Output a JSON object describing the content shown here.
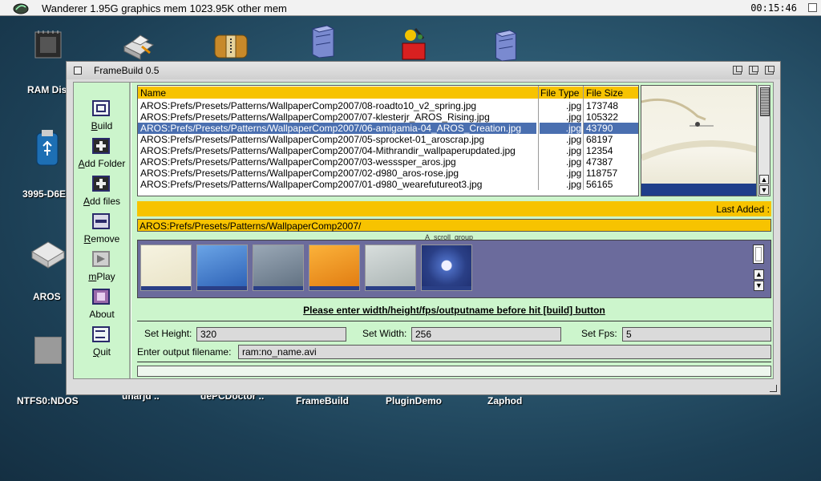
{
  "menubar": {
    "title": "Wanderer 1.95G graphics mem 1023.95K other mem",
    "clock": "00:15:46"
  },
  "desktop": {
    "icons": [
      {
        "label": "RAM Dis",
        "icon": "chip-icon"
      },
      {
        "label": "3995-D6E",
        "icon": "usb-drive-icon"
      },
      {
        "label": "AROS",
        "icon": "hard-drive-icon"
      },
      {
        "label": "NTFS0:NDOS",
        "icon": "volume-icon"
      },
      {
        "label": "FrameBuild",
        "icon": "cabinet-icon"
      },
      {
        "label": "PluginDemo",
        "icon": "paint-icon"
      },
      {
        "label": "Zaphod",
        "icon": "cabinet-icon"
      },
      {
        "label": "unarjd ..",
        "icon": "printer-icon"
      },
      {
        "label": "dePCDoctor ..",
        "icon": "archive-icon"
      }
    ]
  },
  "window": {
    "title": "FrameBuild 0.5",
    "toolbar": [
      {
        "label": "Build",
        "ul": "B",
        "rest": "uild"
      },
      {
        "label": "Add Folder",
        "ul": "A",
        "rest": "dd Folder"
      },
      {
        "label": "Add files",
        "ul": "A",
        "rest": "dd files"
      },
      {
        "label": "Remove",
        "ul": "R",
        "rest": "emove"
      },
      {
        "label": "mPlay",
        "ul": "m",
        "rest": "Play"
      },
      {
        "label": "About",
        "ul": "",
        "rest": "About"
      },
      {
        "label": "Quit",
        "ul": "Q",
        "rest": "uit"
      }
    ],
    "filelist": {
      "headers": {
        "name": "Name",
        "type": "File Type",
        "size": "File Size"
      },
      "rows": [
        {
          "name": "AROS:Prefs/Presets/Patterns/WallpaperComp2007/08-roadto10_v2_spring.jpg",
          "type": ".jpg",
          "size": "173748"
        },
        {
          "name": "AROS:Prefs/Presets/Patterns/WallpaperComp2007/07-klesterjr_AROS_Rising.jpg",
          "type": ".jpg",
          "size": "105322"
        },
        {
          "name": "AROS:Prefs/Presets/Patterns/WallpaperComp2007/06-amigamia-04_AROS_Creation.jpg",
          "type": ".jpg",
          "size": "43790",
          "selected": true
        },
        {
          "name": "AROS:Prefs/Presets/Patterns/WallpaperComp2007/05-sprocket-01_aroscrap.jpg",
          "type": ".jpg",
          "size": "68197"
        },
        {
          "name": "AROS:Prefs/Presets/Patterns/WallpaperComp2007/04-Mithrandir_wallpaperupdated.jpg",
          "type": ".jpg",
          "size": "12354"
        },
        {
          "name": "AROS:Prefs/Presets/Patterns/WallpaperComp2007/03-wesssper_aros.jpg",
          "type": ".jpg",
          "size": "47387"
        },
        {
          "name": "AROS:Prefs/Presets/Patterns/WallpaperComp2007/02-d980_aros-rose.jpg",
          "type": ".jpg",
          "size": "118757"
        },
        {
          "name": "AROS:Prefs/Presets/Patterns/WallpaperComp2007/01-d980_wearefutureot3.jpg",
          "type": ".jpg",
          "size": "56165"
        }
      ]
    },
    "last_added_label": "Last Added :",
    "last_added_path": "AROS:Prefs/Presets/Patterns/WallpaperComp2007/",
    "scroll_group_label": "A_scroll_group",
    "thumbnails": [
      {
        "color": "#f4f1dc"
      },
      {
        "color": "#3f7fd0"
      },
      {
        "color": "#8a9aaa"
      },
      {
        "color": "#f29a1a"
      },
      {
        "color": "#c9d0cf"
      },
      {
        "color": "#2a3f86"
      }
    ],
    "instruction": "Please enter width/height/fps/outputname before hit [build] button",
    "fields": {
      "height_label": "Set Height:",
      "height_value": "320",
      "width_label": "Set Width:",
      "width_value": "256",
      "fps_label": "Set Fps:",
      "fps_value": "5",
      "output_label": "Enter output filename:",
      "output_value": "ram:no_name.avi"
    }
  }
}
